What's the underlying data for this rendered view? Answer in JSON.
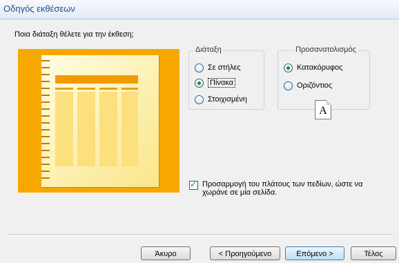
{
  "window": {
    "title": "Οδηγός εκθέσεων"
  },
  "question": "Ποια διάταξη θέλετε για την έκθεση;",
  "layout_group": {
    "legend": "Διάταξη",
    "options": [
      {
        "label": "Σε στήλες",
        "checked": false
      },
      {
        "label": "Πίνακα",
        "checked": true
      },
      {
        "label": "Στοιχισμένη",
        "checked": false
      }
    ]
  },
  "orientation_group": {
    "legend": "Προσανατολισμός",
    "options": [
      {
        "label": "Κατακόρυφος",
        "checked": true
      },
      {
        "label": "Οριζόντιος",
        "checked": false
      }
    ],
    "icon_letter": "A"
  },
  "fit_checkbox": {
    "label": "Προσαρμογή του πλάτους των πεδίων, ώστε να χωράνε σε μία σελίδα.",
    "checked": true
  },
  "buttons": {
    "cancel": "Άκυρο",
    "back": "< Προηγούμενο",
    "next": "Επόμενο >",
    "finish": "Τέλος"
  }
}
